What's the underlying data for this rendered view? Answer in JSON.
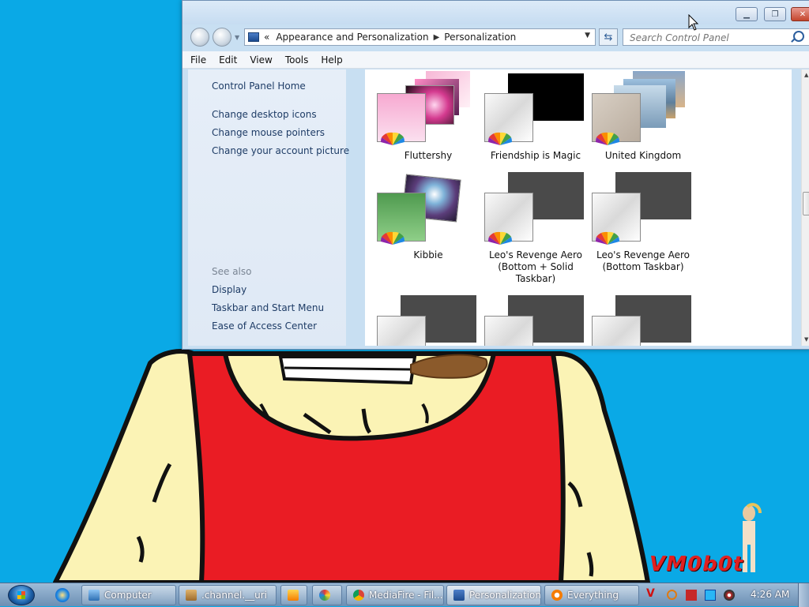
{
  "window": {
    "title": "Personalization",
    "address": {
      "overflow_marker": "«",
      "crumbs": [
        "Appearance and Personalization",
        "Personalization"
      ]
    },
    "search_placeholder": "Search Control Panel",
    "menu": [
      "File",
      "Edit",
      "View",
      "Tools",
      "Help"
    ],
    "left_pane": {
      "home_link": "Control Panel Home",
      "tasks": [
        "Change desktop icons",
        "Change mouse pointers",
        "Change your account picture"
      ],
      "see_also_heading": "See also",
      "see_also": [
        "Display",
        "Taskbar and Start Menu",
        "Ease of Access Center"
      ]
    },
    "themes": [
      {
        "name": "Fluttershy"
      },
      {
        "name": "Friendship is Magic"
      },
      {
        "name": "United Kingdom"
      },
      {
        "name": "Kibbie"
      },
      {
        "name": "Leo's Revenge Aero (Bottom + Solid Taskbar)"
      },
      {
        "name": "Leo's Revenge Aero (Bottom Taskbar)"
      },
      {
        "name": ""
      },
      {
        "name": ""
      },
      {
        "name": ""
      }
    ]
  },
  "taskbar": {
    "buttons": [
      {
        "label": "Computer",
        "icon": "computer-icon",
        "active": false
      },
      {
        "label": ".channel.__uri",
        "icon": "folder-icon",
        "active": false
      },
      {
        "label": "",
        "icon": "media-player-icon",
        "active": false
      },
      {
        "label": "",
        "icon": "paint-icon",
        "active": false
      },
      {
        "label": "MediaFire - Fil...",
        "icon": "chrome-icon",
        "active": false
      },
      {
        "label": "Personalization",
        "icon": "control-panel-icon",
        "active": true
      },
      {
        "label": "Everything",
        "icon": "search-icon",
        "active": false
      }
    ],
    "clock": "4:26 AM"
  },
  "desktop": {
    "logo_text": "VM0b0t"
  },
  "colors": {
    "desktop": "#0aa9e6",
    "shirt": "#ea1c24",
    "skin": "#fbf3b5",
    "logo": "#e02020"
  }
}
